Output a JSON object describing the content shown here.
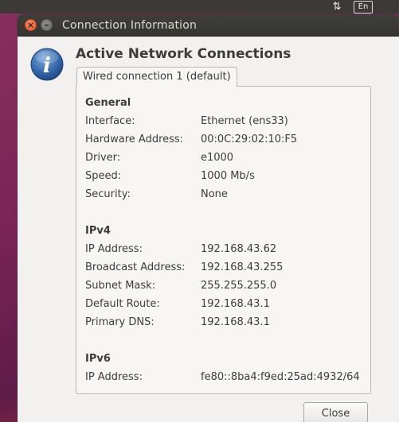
{
  "topbar": {
    "network_icon": "up-down-arrows-icon",
    "network_glyph": "⇅",
    "language": "En"
  },
  "window": {
    "title": "Connection Information",
    "close_glyph": "×",
    "minimize_glyph": "–"
  },
  "dialog": {
    "heading": "Active Network Connections",
    "info_icon_glyph": "i",
    "tab_label": "Wired connection 1 (default)",
    "close_button": "Close"
  },
  "sections": {
    "general": {
      "title": "General",
      "rows": [
        {
          "label": "Interface:",
          "value": "Ethernet (ens33)"
        },
        {
          "label": "Hardware Address:",
          "value": "00:0C:29:02:10:F5"
        },
        {
          "label": "Driver:",
          "value": "e1000"
        },
        {
          "label": "Speed:",
          "value": "1000 Mb/s"
        },
        {
          "label": "Security:",
          "value": "None"
        }
      ]
    },
    "ipv4": {
      "title": "IPv4",
      "rows": [
        {
          "label": "IP Address:",
          "value": "192.168.43.62"
        },
        {
          "label": "Broadcast Address:",
          "value": "192.168.43.255"
        },
        {
          "label": "Subnet Mask:",
          "value": "255.255.255.0"
        },
        {
          "label": "Default Route:",
          "value": "192.168.43.1"
        },
        {
          "label": "Primary DNS:",
          "value": "192.168.43.1"
        }
      ]
    },
    "ipv6": {
      "title": "IPv6",
      "rows": [
        {
          "label": "IP Address:",
          "value": "fe80::8ba4:f9ed:25ad:4932/64"
        }
      ]
    }
  },
  "colors": {
    "desktop": "#7a2457",
    "titlebar": "#3c3b37",
    "dialog_bg": "#f2f1f0",
    "close_button_orange": "#e9622e",
    "text": "#3c3c3c"
  }
}
